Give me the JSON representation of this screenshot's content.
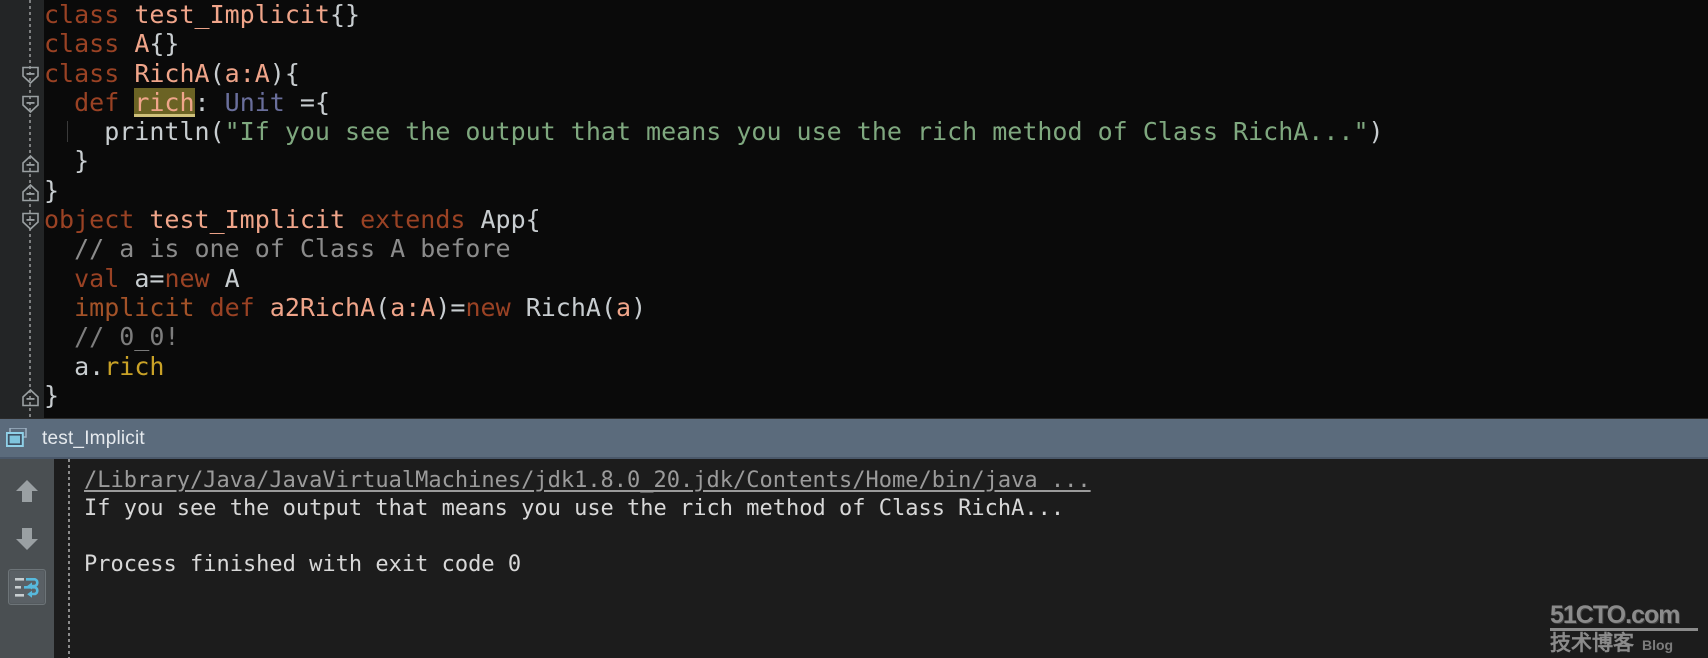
{
  "editor": {
    "language": "scala",
    "background": "#0a0a0a",
    "gutter_background": "#232526",
    "lines": [
      {
        "indent": 0,
        "fold": null,
        "tokens": [
          {
            "t": "class ",
            "c": "kw"
          },
          {
            "t": "test_Implicit",
            "c": "ident"
          },
          {
            "t": "{}",
            "c": "plain"
          }
        ]
      },
      {
        "indent": 0,
        "fold": null,
        "tokens": [
          {
            "t": "class ",
            "c": "kw"
          },
          {
            "t": "A",
            "c": "ident"
          },
          {
            "t": "{}",
            "c": "plain"
          }
        ]
      },
      {
        "indent": 0,
        "fold": "collapse",
        "tokens": [
          {
            "t": "class ",
            "c": "kw"
          },
          {
            "t": "RichA",
            "c": "ident"
          },
          {
            "t": "(",
            "c": "plain"
          },
          {
            "t": "a:A",
            "c": "ident"
          },
          {
            "t": ")",
            "c": "plain"
          },
          {
            "t": "{",
            "c": "plain"
          }
        ]
      },
      {
        "indent": 1,
        "fold": "collapse",
        "tokens": [
          {
            "t": "def ",
            "c": "kw"
          },
          {
            "t": "rich",
            "c": "hl"
          },
          {
            "t": ": ",
            "c": "plain"
          },
          {
            "t": "Unit",
            "c": "type"
          },
          {
            "t": " =",
            "c": "plain"
          },
          {
            "t": "{",
            "c": "plain"
          }
        ]
      },
      {
        "indent": 2,
        "fold": null,
        "guide": true,
        "tokens": [
          {
            "t": "println",
            "c": "plain"
          },
          {
            "t": "(",
            "c": "plain"
          },
          {
            "t": "\"If you see the output that means you use the rich method of Class RichA...\"",
            "c": "str"
          },
          {
            "t": ")",
            "c": "plain"
          }
        ]
      },
      {
        "indent": 1,
        "fold": "end",
        "tokens": [
          {
            "t": "}",
            "c": "plain"
          }
        ]
      },
      {
        "indent": 0,
        "fold": "end",
        "tokens": [
          {
            "t": "}",
            "c": "plain"
          }
        ]
      },
      {
        "indent": 0,
        "fold": "collapse",
        "tokens": [
          {
            "t": "object ",
            "c": "kw"
          },
          {
            "t": "test_Implicit",
            "c": "ident"
          },
          {
            "t": " extends ",
            "c": "kw"
          },
          {
            "t": "App",
            "c": "plain"
          },
          {
            "t": "{",
            "c": "plain"
          }
        ]
      },
      {
        "indent": 1,
        "fold": null,
        "tokens": [
          {
            "t": "// a is one of Class A before",
            "c": "cmt2"
          }
        ]
      },
      {
        "indent": 1,
        "fold": null,
        "tokens": [
          {
            "t": "val ",
            "c": "kw"
          },
          {
            "t": "a",
            "c": "plain"
          },
          {
            "t": "=",
            "c": "plain"
          },
          {
            "t": "new",
            "c": "kw"
          },
          {
            "t": " A",
            "c": "plain"
          }
        ]
      },
      {
        "indent": 1,
        "fold": null,
        "tokens": [
          {
            "t": "implicit ",
            "c": "kw2"
          },
          {
            "t": "def ",
            "c": "kw"
          },
          {
            "t": "a2RichA",
            "c": "ident"
          },
          {
            "t": "(",
            "c": "plain"
          },
          {
            "t": "a:A",
            "c": "ident"
          },
          {
            "t": ")",
            "c": "plain"
          },
          {
            "t": "=",
            "c": "plain"
          },
          {
            "t": "new",
            "c": "kw"
          },
          {
            "t": " RichA",
            "c": "plain"
          },
          {
            "t": "(",
            "c": "plain"
          },
          {
            "t": "a",
            "c": "ident"
          },
          {
            "t": ")",
            "c": "plain"
          }
        ]
      },
      {
        "indent": 1,
        "fold": null,
        "tokens": [
          {
            "t": "// 0_0!",
            "c": "cmt"
          }
        ]
      },
      {
        "indent": 1,
        "fold": null,
        "tokens": [
          {
            "t": "a",
            "c": "plain"
          },
          {
            "t": ".",
            "c": "plain"
          },
          {
            "t": "rich",
            "c": "method"
          }
        ]
      },
      {
        "indent": 0,
        "fold": "end",
        "tokens": [
          {
            "t": "}",
            "c": "plain"
          }
        ]
      }
    ]
  },
  "run_tool_window": {
    "tab_label": "test_Implicit",
    "tab_icon": "run-configuration-icon",
    "tab_background": "#5b6b7c",
    "toolbar": {
      "buttons": [
        {
          "name": "scroll-up-button",
          "icon": "arrow-up-icon",
          "label": "Up the Stack Trace",
          "selected": false
        },
        {
          "name": "scroll-down-button",
          "icon": "arrow-down-icon",
          "label": "Down the Stack Trace",
          "selected": false
        },
        {
          "name": "soft-wrap-button",
          "icon": "soft-wrap-icon",
          "label": "Use Soft Wraps",
          "selected": true
        }
      ]
    },
    "console": {
      "background": "#1c1c1c",
      "lines": [
        {
          "text": "/Library/Java/JavaVirtualMachines/jdk1.8.0_20.jdk/Contents/Home/bin/java ...",
          "style": "link"
        },
        {
          "text": "If you see the output that means you use the rich method of Class RichA...",
          "style": "normal"
        },
        {
          "text": " ",
          "style": "blank"
        },
        {
          "text": "Process finished with exit code 0",
          "style": "normal"
        }
      ]
    }
  },
  "watermark": {
    "site": "51CTO.com",
    "subtitle": "技术博客",
    "badge": "Blog"
  }
}
